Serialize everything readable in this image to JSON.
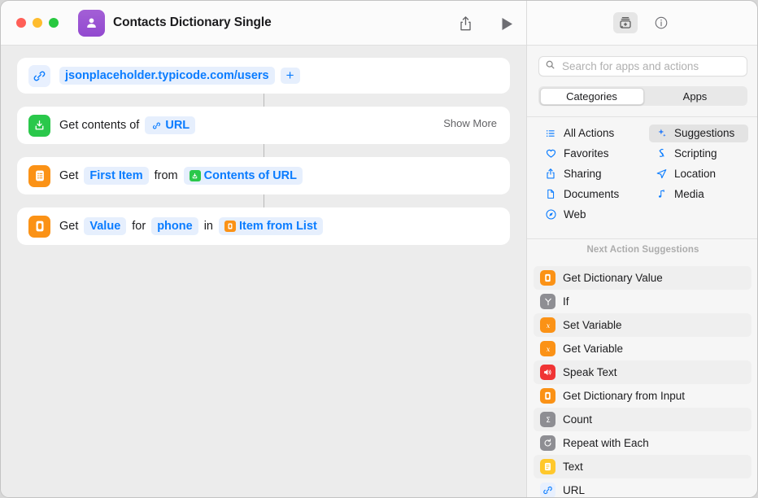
{
  "window": {
    "traffic_lights": [
      "close",
      "minimize",
      "zoom"
    ],
    "colors": {
      "close": "#ff5f57",
      "minimize": "#febc2e",
      "zoom": "#28c840",
      "accent_blue": "#0a7cff",
      "icon_orange": "#fb9216",
      "icon_green": "#2ac84b",
      "icon_gray": "#8e8e93",
      "icon_red": "#f03434",
      "icon_yellow": "#ffc82c",
      "app_purple": "#9249cf"
    }
  },
  "titlebar": {
    "app_icon": "contacts-person-icon",
    "title": "Contacts Dictionary Single",
    "share_icon": "share-icon",
    "play_icon": "play-icon"
  },
  "workflow": {
    "actions": [
      {
        "icon": "link-icon",
        "icon_style": "plain",
        "parts": [
          {
            "type": "token",
            "text": "jsonplaceholder.typicode.com/users"
          },
          {
            "type": "plus",
            "text": "+"
          }
        ],
        "show_more": ""
      },
      {
        "icon": "download-icon",
        "icon_style": "green",
        "parts": [
          {
            "type": "text",
            "text": "Get contents of"
          },
          {
            "type": "token-link",
            "text": "URL"
          }
        ],
        "show_more": "Show More"
      },
      {
        "icon": "list-icon",
        "icon_style": "orange",
        "parts": [
          {
            "type": "text",
            "text": "Get"
          },
          {
            "type": "token",
            "text": "First Item"
          },
          {
            "type": "text",
            "text": "from"
          },
          {
            "type": "token-green",
            "text": "Contents of URL"
          }
        ],
        "show_more": ""
      },
      {
        "icon": "dictionary-icon",
        "icon_style": "orange",
        "parts": [
          {
            "type": "text",
            "text": "Get"
          },
          {
            "type": "token",
            "text": "Value"
          },
          {
            "type": "text",
            "text": "for"
          },
          {
            "type": "token",
            "text": "phone"
          },
          {
            "type": "text",
            "text": "in"
          },
          {
            "type": "token-orange",
            "text": "Item from List"
          }
        ],
        "show_more": ""
      }
    ]
  },
  "sidebar": {
    "toolbar": {
      "library_icon": "action-library-icon",
      "info_icon": "info-circle-icon"
    },
    "search": {
      "icon": "search-icon",
      "placeholder": "Search for apps and actions",
      "value": ""
    },
    "segmented": {
      "options": [
        "Categories",
        "Apps"
      ],
      "selected": "Categories"
    },
    "categories": [
      {
        "label": "All Actions",
        "icon": "list-bullet-icon",
        "selected": false
      },
      {
        "label": "Suggestions",
        "icon": "sparkles-icon",
        "selected": true
      },
      {
        "label": "Favorites",
        "icon": "heart-icon",
        "selected": false
      },
      {
        "label": "Scripting",
        "icon": "scripting-icon",
        "selected": false
      },
      {
        "label": "Sharing",
        "icon": "share-icon",
        "selected": false
      },
      {
        "label": "Location",
        "icon": "location-arrow-icon",
        "selected": false
      },
      {
        "label": "Documents",
        "icon": "document-icon",
        "selected": false
      },
      {
        "label": "Media",
        "icon": "music-note-icon",
        "selected": false
      },
      {
        "label": "Web",
        "icon": "safari-compass-icon",
        "selected": false
      }
    ],
    "suggestions_header": "Next Action Suggestions",
    "suggestions": [
      {
        "label": "Get Dictionary Value",
        "icon": "dictionary-icon",
        "color": "bg-orange"
      },
      {
        "label": "If",
        "icon": "branch-icon",
        "color": "bg-gray"
      },
      {
        "label": "Set Variable",
        "icon": "variable-icon",
        "color": "bg-orange"
      },
      {
        "label": "Get Variable",
        "icon": "variable-icon",
        "color": "bg-orange"
      },
      {
        "label": "Speak Text",
        "icon": "speaker-icon",
        "color": "bg-red"
      },
      {
        "label": "Get Dictionary from Input",
        "icon": "dictionary-icon",
        "color": "bg-orange"
      },
      {
        "label": "Count",
        "icon": "sigma-icon",
        "color": "bg-gray"
      },
      {
        "label": "Repeat with Each",
        "icon": "repeat-icon",
        "color": "bg-gray"
      },
      {
        "label": "Text",
        "icon": "text-lines-icon",
        "color": "bg-yellow"
      },
      {
        "label": "URL",
        "icon": "link-icon",
        "color": "bg-blue-l"
      }
    ]
  }
}
